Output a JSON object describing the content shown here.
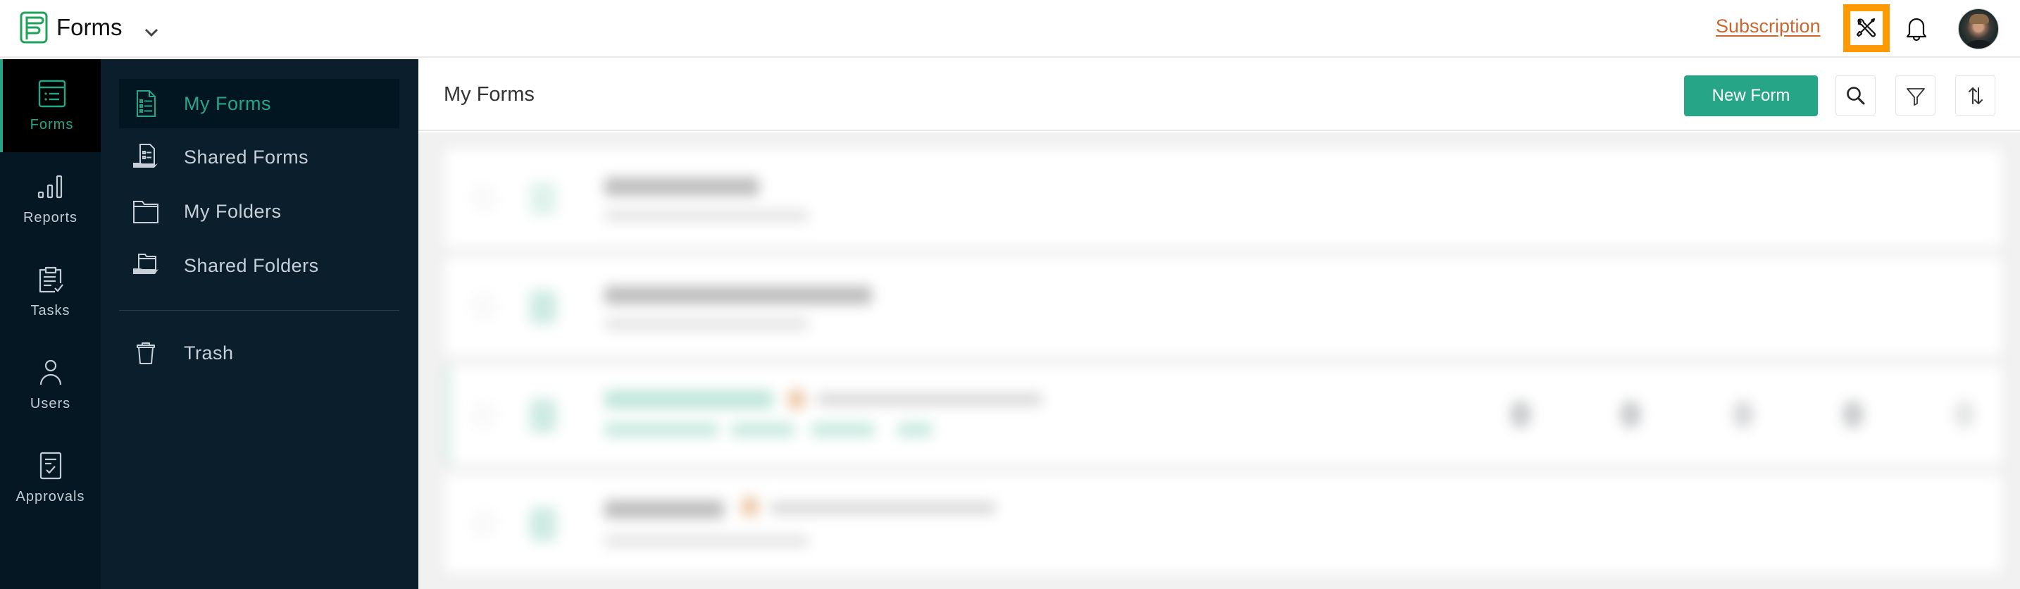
{
  "app": {
    "name": "Forms",
    "colors": {
      "brand_green": "#26a687",
      "subscription_orange": "#c8672f",
      "highlight_orange": "#ff9900",
      "rail_bg": "#041722",
      "subnav_bg": "#0a1e2b"
    }
  },
  "topbar": {
    "logo_icon": "forms-logo-icon",
    "app_switcher_icon": "chevron-down-icon",
    "subscription_label": "Subscription",
    "tools_icon": "tools-icon",
    "tools_highlighted": true,
    "notifications_icon": "bell-icon",
    "avatar": "user-avatar"
  },
  "rail": {
    "items": [
      {
        "label": "Forms",
        "icon": "form-list-icon",
        "active": true
      },
      {
        "label": "Reports",
        "icon": "bar-chart-icon",
        "active": false
      },
      {
        "label": "Tasks",
        "icon": "clipboard-check-icon",
        "active": false
      },
      {
        "label": "Users",
        "icon": "user-icon",
        "active": false
      },
      {
        "label": "Approvals",
        "icon": "document-check-icon",
        "active": false
      }
    ]
  },
  "subnav": {
    "items": [
      {
        "label": "My Forms",
        "icon": "form-document-icon",
        "active": true
      },
      {
        "label": "Shared Forms",
        "icon": "shared-form-icon",
        "active": false
      },
      {
        "label": "My Folders",
        "icon": "folder-icon",
        "active": false
      },
      {
        "label": "Shared Folders",
        "icon": "shared-folder-icon",
        "active": false
      }
    ],
    "trash": {
      "label": "Trash",
      "icon": "trash-icon"
    }
  },
  "main": {
    "title": "My Forms",
    "new_form_label": "New Form",
    "toolbar_icons": [
      "search-icon",
      "filter-icon",
      "sort-icon"
    ],
    "form_list": {
      "blurred": true,
      "row_count": 4
    }
  }
}
